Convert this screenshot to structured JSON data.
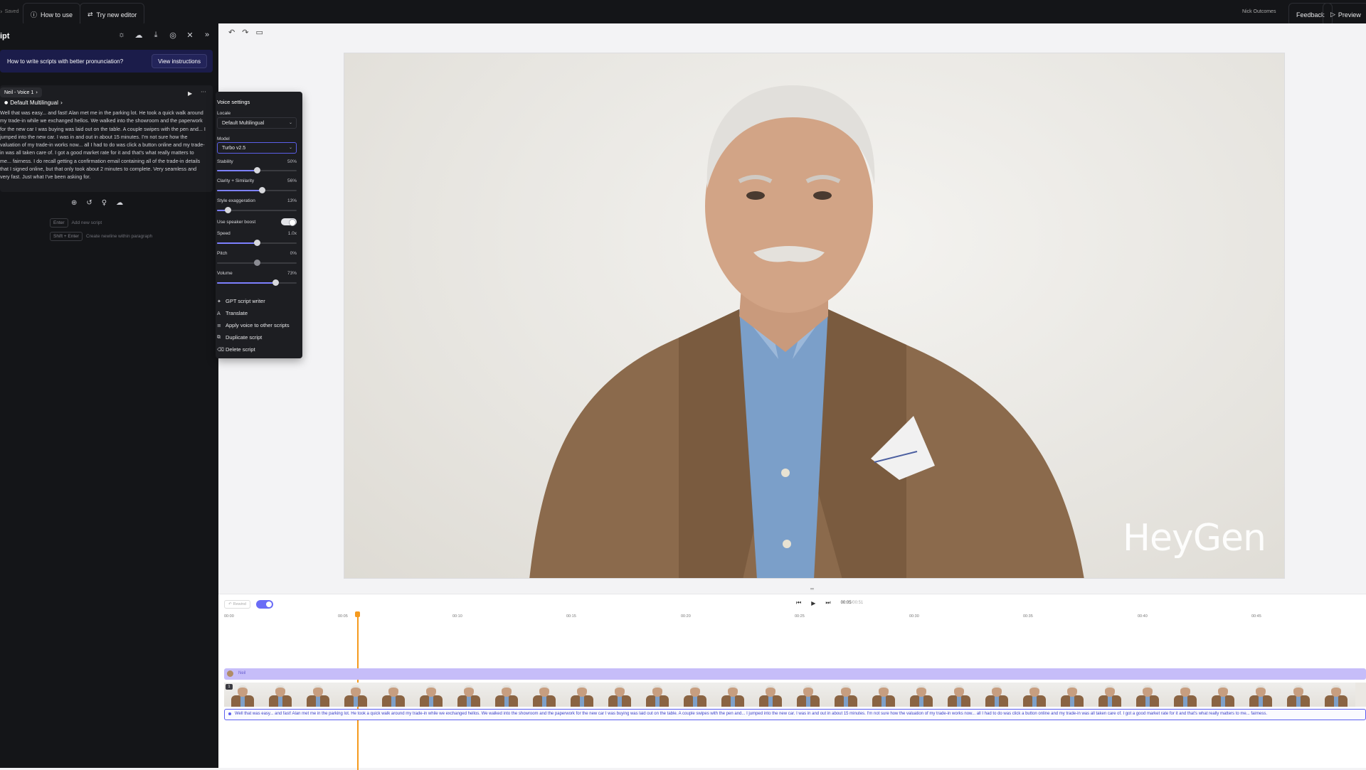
{
  "topbar": {
    "saved": "Saved",
    "how_to_use": "How to use",
    "try_new_editor": "Try new editor",
    "user_name": "Nick Outcomes",
    "feedback": "Feedback",
    "preview": "Preview"
  },
  "left_panel": {
    "title": "ipt",
    "tip_text": "How to write scripts with better pronunciation?",
    "tip_button": "View instructions",
    "voice_chip": "Neil - Voice 1",
    "model_chip": "Default Multilingual",
    "script_text": "Well that was easy... and fast! Alan met me in the parking lot. He took a quick walk around my trade-in while we exchanged hellos. We walked into the showroom and the paperwork for the new car I was buying was laid out on the table. A couple swipes with the pen and... I jumped into the new car. I was in and out in about 15 minutes. I'm not sure how the valuation of my trade-in works now... all I had to do was click a button online and my trade-in was all taken care of. I got a good market rate for it and that's what really matters to me... fairness. I do recall getting a confirmation email containing all of the trade-in details that I signed online, but that only took about 2 minutes to complete. Very seamless and very fast. Just what I've been asking for.",
    "hint_enter_key": "Enter",
    "hint_enter_text": "Add new script",
    "hint_shift_key": "Shift + Enter",
    "hint_shift_text": "Create newline within paragraph"
  },
  "voice_settings": {
    "title": "Voice settings",
    "locale_label": "Locale",
    "locale_value": "Default Multilingual",
    "model_label": "Model",
    "model_value": "Turbo v2.5",
    "stability_label": "Stability",
    "stability_value": "50%",
    "stability_level": 0.5,
    "clarity_label": "Clarity + Similarity",
    "clarity_value": "56%",
    "clarity_level": 0.56,
    "style_label": "Style exaggeration",
    "style_value": "13%",
    "style_level": 0.13,
    "speaker_boost_label": "Use speaker boost",
    "speed_label": "Speed",
    "speed_value": "1.0x",
    "speed_level": 0.5,
    "pitch_label": "Pitch",
    "pitch_value": "0%",
    "pitch_level": 0.5,
    "volume_label": "Volume",
    "volume_value": "73%",
    "volume_level": 0.73,
    "menu": {
      "gpt": "GPT script writer",
      "translate": "Translate",
      "apply_voice": "Apply voice to other scripts",
      "duplicate": "Duplicate script",
      "delete": "Delete script"
    }
  },
  "canvas": {
    "watermark": "HeyGen"
  },
  "timeline": {
    "rewind": "Rewind",
    "current_time": "00:05",
    "duration": "/00:51",
    "ruler": [
      "00:00",
      "00:05",
      "00:10",
      "00:15",
      "00:20",
      "00:25",
      "00:30",
      "00:35",
      "00:40",
      "00:45"
    ],
    "voice_track": "Neil",
    "track_number": "1",
    "script_track": "Well that was easy... and fast! Alan met me in the parking lot. He took a quick walk around my trade-in while we exchanged hellos. We walked into the showroom and the paperwork for the new car I was buying was laid out on the table. A couple swipes with the pen and... I jumped into the new car. I was in and out in about 15 minutes. I'm not sure how the valuation of my trade-in works now... all I had to do was click a button online and my trade-in was all taken care of. I got a good market rate for it and that's what really matters to me... fairness."
  },
  "colors": {
    "accent": "#6a6cf6",
    "playhead": "#f59a1e",
    "panel_bg": "#141518"
  }
}
